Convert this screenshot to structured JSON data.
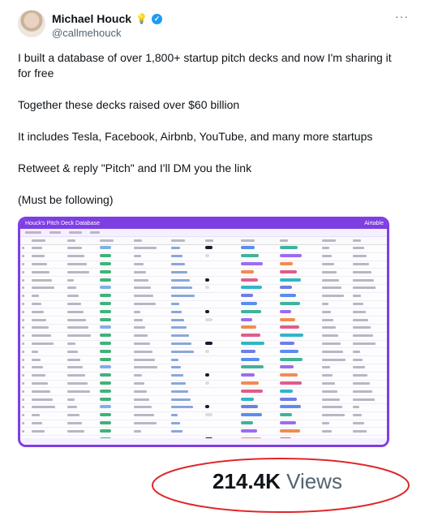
{
  "author": {
    "name": "Michael Houck",
    "badge_emoji": "💡",
    "handle": "@callmehouck"
  },
  "more_label": "···",
  "tweet": {
    "paragraphs": [
      "I built a database of over 1,800+ startup pitch decks and now I'm sharing it for free",
      "Together these decks raised over $60 billion",
      "It includes Tesla, Facebook, Airbnb, YouTube, and many more startups",
      "Retweet & reply \"Pitch\" and I'll DM you the link",
      "(Must be following)"
    ]
  },
  "media": {
    "title": "Houck's Pitch Deck Database",
    "brand": "Airtable",
    "accent": "#7e3fe2"
  },
  "stats": {
    "views_count": "214.4K",
    "views_label": "Views"
  },
  "annotation": {
    "ring_color": "#e0262a"
  }
}
